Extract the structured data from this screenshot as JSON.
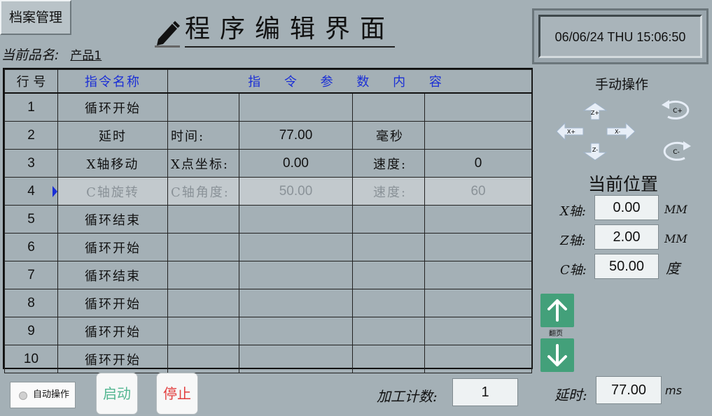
{
  "header": {
    "archive_button": "档案管理",
    "title": "程序编辑界面",
    "datetime": "06/06/24 THU  15:06:50",
    "product_label": "当前品名:",
    "product_name": "产品1"
  },
  "table": {
    "headers": [
      "行 号",
      "指令名称",
      "指 令 参 数 内 容"
    ],
    "selected_row": 4,
    "rows": [
      {
        "no": "1",
        "cmd": "循环开始",
        "p1": "",
        "p2": "",
        "p3": "",
        "p4": ""
      },
      {
        "no": "2",
        "cmd": "延时",
        "p1": "时间:",
        "p2": "77.00",
        "p3": "毫秒",
        "p4": ""
      },
      {
        "no": "3",
        "cmd": "X轴移动",
        "p1": "X点坐标:",
        "p2": "0.00",
        "p3": "速度:",
        "p4": "0"
      },
      {
        "no": "4",
        "cmd": "C轴旋转",
        "p1": "C轴角度:",
        "p2": "50.00",
        "p3": "速度:",
        "p4": "60"
      },
      {
        "no": "5",
        "cmd": "循环结束",
        "p1": "",
        "p2": "",
        "p3": "",
        "p4": ""
      },
      {
        "no": "6",
        "cmd": "循环开始",
        "p1": "",
        "p2": "",
        "p3": "",
        "p4": ""
      },
      {
        "no": "7",
        "cmd": "循环结束",
        "p1": "",
        "p2": "",
        "p3": "",
        "p4": ""
      },
      {
        "no": "8",
        "cmd": "循环开始",
        "p1": "",
        "p2": "",
        "p3": "",
        "p4": ""
      },
      {
        "no": "9",
        "cmd": "循环开始",
        "p1": "",
        "p2": "",
        "p3": "",
        "p4": ""
      },
      {
        "no": "10",
        "cmd": "循环开始",
        "p1": "",
        "p2": "",
        "p3": "",
        "p4": ""
      }
    ]
  },
  "manual": {
    "title": "手动操作",
    "jog": {
      "z_plus": "Z+",
      "z_minus": "Z-",
      "x_plus": "X+",
      "x_minus": "X-",
      "c_plus": "C+",
      "c_minus": "C-"
    }
  },
  "position": {
    "title": "当前位置",
    "x_label": "X轴:",
    "x_value": "0.00",
    "x_unit": "MM",
    "z_label": "Z轴:",
    "z_value": "2.00",
    "z_unit": "MM",
    "c_label": "C轴:",
    "c_value": "50.00",
    "c_unit": "度"
  },
  "paging": {
    "label": "翻页"
  },
  "footer": {
    "auto_label": "自动操作",
    "start_label": "启动",
    "stop_label": "停止",
    "count_label": "加工计数:",
    "count_value": "1",
    "delay_label": "延时:",
    "delay_value": "77.00",
    "delay_unit": "ms"
  },
  "colors": {
    "background": "#a4b0b6",
    "header_blue": "#1b2fd6",
    "page_button_green": "#43a07a",
    "start_green": "#52b690",
    "stop_red": "#e23c3c"
  }
}
